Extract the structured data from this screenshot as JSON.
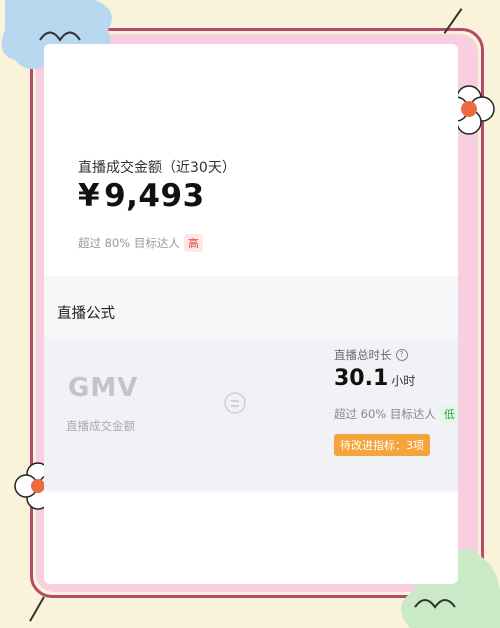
{
  "live_sales": {
    "title": "直播成交金额（近30天）",
    "currency_symbol": "¥",
    "amount": "9,493",
    "exceed_text": "超过 80% 目标达人",
    "level": "高"
  },
  "formula": {
    "title": "直播公式",
    "lhs_code": "GMV",
    "lhs_label": "直播成交金额",
    "metric": {
      "label": "直播总时长",
      "value": "30.1",
      "unit": "小时",
      "exceed_text": "超过 60% 目标达人",
      "level": "低",
      "pending": "待改进指标：3项"
    }
  },
  "colors": {
    "high": "#e2443a",
    "low": "#2aa54a",
    "pending": "#f5a33b",
    "frame_pink": "#f8cfe0",
    "frame_border": "#b44b6a",
    "background": "#fbf3d9"
  },
  "icons": [
    "help-icon",
    "equal-icon",
    "flower-icon"
  ]
}
